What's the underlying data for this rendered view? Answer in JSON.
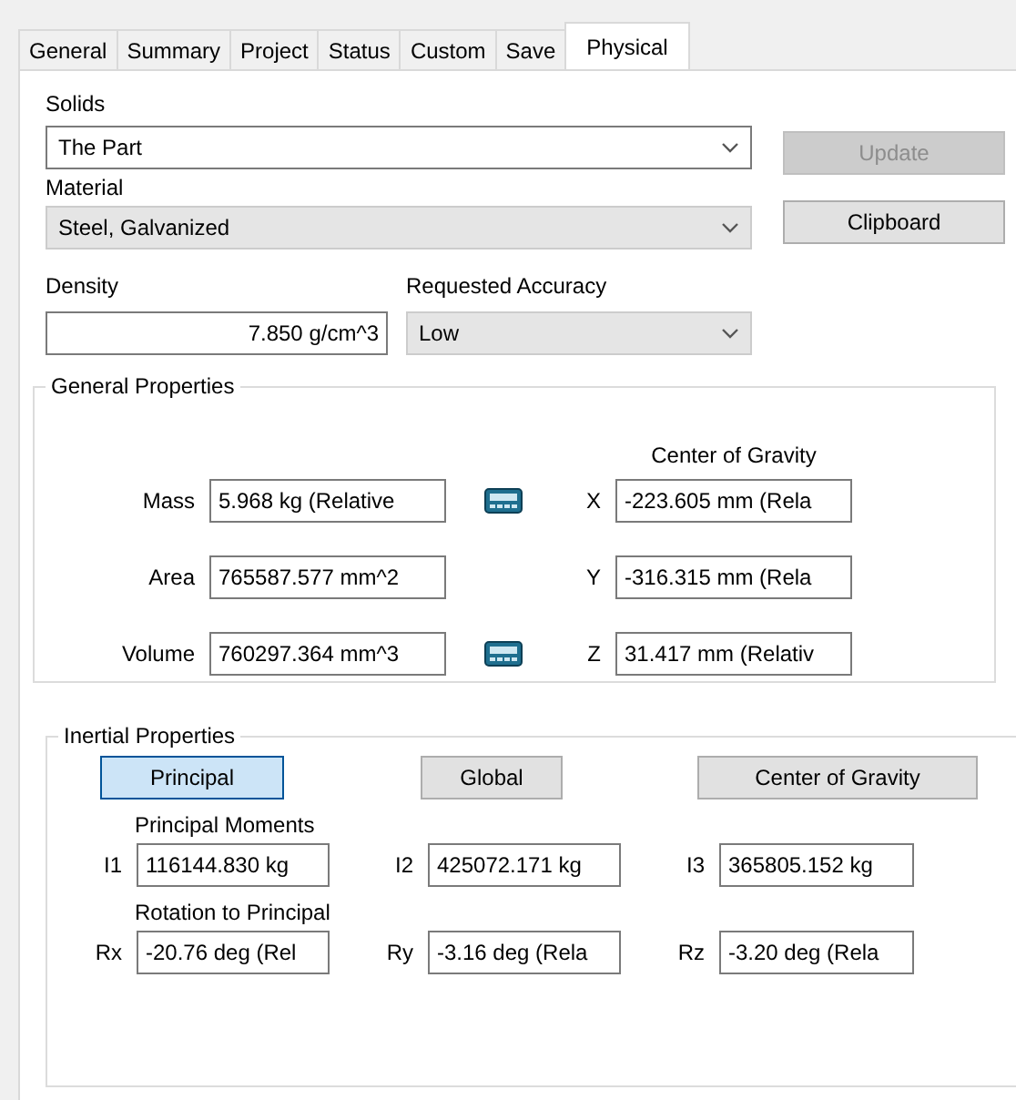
{
  "tabs": [
    {
      "label": "General",
      "selected": false
    },
    {
      "label": "Summary",
      "selected": false
    },
    {
      "label": "Project",
      "selected": false
    },
    {
      "label": "Status",
      "selected": false
    },
    {
      "label": "Custom",
      "selected": false
    },
    {
      "label": "Save",
      "selected": false
    },
    {
      "label": "Physical",
      "selected": true
    }
  ],
  "solids": {
    "label": "Solids",
    "value": "The Part",
    "disabled": false
  },
  "material": {
    "label": "Material",
    "value": "Steel, Galvanized",
    "disabled": true
  },
  "density": {
    "label": "Density",
    "value": "7.850 g/cm^3"
  },
  "accuracy": {
    "label": "Requested Accuracy",
    "value": "Low",
    "disabled": true
  },
  "buttons": [
    {
      "label": "Update",
      "disabled": true
    },
    {
      "label": "Clipboard",
      "disabled": false
    }
  ],
  "general_properties": {
    "title": "General Properties",
    "center_of_gravity_label": "Center of Gravity",
    "rows": [
      {
        "label": "Mass",
        "value": "5.968 kg (Relative",
        "calculator": true,
        "axis": "X",
        "axis_value": "-223.605 mm (Rela"
      },
      {
        "label": "Area",
        "value": "765587.577 mm^2",
        "calculator": false,
        "axis": "Y",
        "axis_value": "-316.315 mm (Rela"
      },
      {
        "label": "Volume",
        "value": "760297.364 mm^3",
        "calculator": true,
        "axis": "Z",
        "axis_value": "31.417 mm (Relativ"
      }
    ]
  },
  "inertial_properties": {
    "title": "Inertial Properties",
    "views": [
      {
        "label": "Principal",
        "selected": true
      },
      {
        "label": "Global",
        "selected": false
      },
      {
        "label": "Center of Gravity",
        "selected": false
      }
    ],
    "moments_label": "Principal Moments",
    "moments": [
      {
        "label": "I1",
        "value": "116144.830 kg"
      },
      {
        "label": "I2",
        "value": "425072.171 kg"
      },
      {
        "label": "I3",
        "value": "365805.152 kg"
      }
    ],
    "rotation_label": "Rotation to Principal",
    "rotations": [
      {
        "label": "Rx",
        "value": "-20.76 deg (Rel"
      },
      {
        "label": "Ry",
        "value": "-3.16 deg (Rela"
      },
      {
        "label": "Rz",
        "value": "-3.20 deg (Rela"
      }
    ]
  }
}
